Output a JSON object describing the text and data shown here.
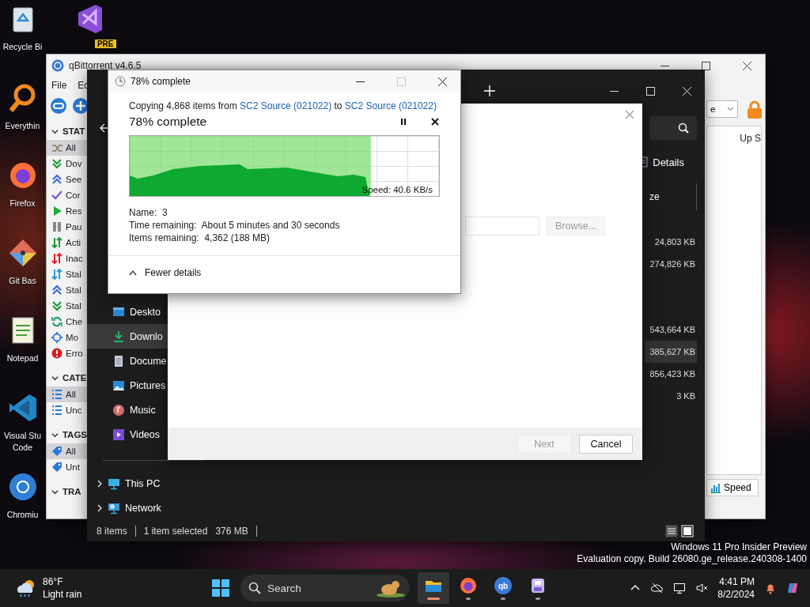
{
  "desktop_icons": [
    {
      "kind": "recycle-bin",
      "label": "Recycle Bi"
    },
    {
      "kind": "visual-studio",
      "badge": "PRE"
    },
    {
      "kind": "everything",
      "label": "Everythin"
    },
    {
      "kind": "firefox",
      "label": "Firefox"
    },
    {
      "kind": "git",
      "label": "Git Bas"
    },
    {
      "kind": "notepad",
      "label": "Notepad"
    },
    {
      "kind": "vscode",
      "label": "Visual Stu\nCode"
    },
    {
      "kind": "chromium",
      "label": "Chromiu"
    }
  ],
  "qbittorrent": {
    "title": "qBittorrent v4.6.5",
    "menu": [
      "File",
      "Ec"
    ],
    "sections": [
      {
        "header": "STAT",
        "expanded": true,
        "items": [
          {
            "kind": "all",
            "label": "All",
            "selected": true
          },
          {
            "kind": "downloading",
            "label": "Dov",
            "selected": false
          },
          {
            "kind": "seeding",
            "label": "See",
            "selected": false
          },
          {
            "kind": "completed",
            "label": "Cor",
            "selected": false
          },
          {
            "kind": "resumed",
            "label": "Res",
            "selected": false
          },
          {
            "kind": "paused",
            "label": "Pau",
            "selected": false
          },
          {
            "kind": "active",
            "label": "Acti",
            "selected": false
          },
          {
            "kind": "inactive",
            "label": "Inac",
            "selected": false
          },
          {
            "kind": "stalled",
            "label": "Stal",
            "selected": false
          },
          {
            "kind": "stalled-up",
            "label": "Stal",
            "selected": false
          },
          {
            "kind": "stalled-down",
            "label": "Stal",
            "selected": false
          },
          {
            "kind": "checking",
            "label": "Che",
            "selected": false
          },
          {
            "kind": "moving",
            "label": "Mo",
            "selected": false
          },
          {
            "kind": "errored",
            "label": "Erro",
            "selected": false
          }
        ]
      },
      {
        "header": "CATE",
        "expanded": true,
        "items": [
          {
            "kind": "category",
            "label": "All",
            "selected": true
          },
          {
            "kind": "category",
            "label": "Unc",
            "selected": false
          }
        ]
      },
      {
        "header": "TAGS",
        "expanded": true,
        "items": [
          {
            "kind": "tag",
            "label": "All",
            "selected": true
          },
          {
            "kind": "tag",
            "label": "Unt",
            "selected": false
          }
        ]
      },
      {
        "header": "TRA",
        "expanded": true
      }
    ],
    "filter_text": "e",
    "column_header": "Up S",
    "speed_button": "Speed"
  },
  "explorer": {
    "details_button": "Details",
    "size_header": "ze",
    "sizes": [
      {
        "value": "24,803 KB",
        "selected": false
      },
      {
        "value": "274,826 KB",
        "selected": false
      },
      {
        "value": "543,664 KB",
        "selected": false
      },
      {
        "value": "385,627 KB",
        "selected": true
      },
      {
        "value": "856,423 KB",
        "selected": false
      },
      {
        "value": "3 KB",
        "selected": false
      }
    ],
    "nav_items": [
      {
        "kind": "desktop",
        "label": "Deskto",
        "selected": false
      },
      {
        "kind": "downloads",
        "label": "Downlo",
        "selected": true
      },
      {
        "kind": "documents",
        "label": "Docume",
        "selected": false
      },
      {
        "kind": "pictures",
        "label": "Pictures",
        "selected": false
      },
      {
        "kind": "music",
        "label": "Music",
        "selected": false
      },
      {
        "kind": "videos",
        "label": "Videos",
        "selected": false
      }
    ],
    "tree_items": [
      {
        "kind": "this-pc",
        "label": "This PC",
        "expanded": false
      },
      {
        "kind": "network",
        "label": "Network",
        "expanded": false
      }
    ],
    "status": {
      "count": "8 items",
      "selection": "1 item selected",
      "size": "376 MB"
    }
  },
  "wizard": {
    "browse": {
      "label": "Browse...",
      "disabled": true
    },
    "buttons": [
      {
        "label": "Next",
        "disabled": true
      },
      {
        "label": "Cancel",
        "disabled": false
      }
    ]
  },
  "copy_dialog": {
    "title": "78% complete",
    "summary": {
      "prefix": "Copying 4,868 items from",
      "source": "SC2 Source (021022)",
      "middle": "to",
      "destination": "SC2 Source (021022)"
    },
    "heading": "78% complete",
    "progress": {
      "level": 0.78,
      "speed": "Speed: 40.6 KB/s"
    },
    "details": [
      {
        "label": "Name:",
        "value": "3"
      },
      {
        "label": "Time remaining:",
        "value": "About 5 minutes and 30 seconds"
      },
      {
        "label": "Items remaining:",
        "value": "4,362 (188 MB)"
      }
    ],
    "toggle": "Fewer details"
  },
  "watermark": [
    "Windows 11 Pro Insider Preview",
    "Evaluation copy. Build 26080.ge_release.240308-1400"
  ],
  "taskbar": {
    "weather": {
      "temp": "86°F",
      "condition": "Light rain"
    },
    "search": {
      "placeholder": "Search"
    },
    "apps": [
      {
        "kind": "file-explorer",
        "active": true
      },
      {
        "kind": "firefox",
        "active": false
      },
      {
        "kind": "qbittorrent",
        "label": "qb",
        "active": false
      },
      {
        "kind": "storage-app",
        "active": false
      }
    ],
    "clock": {
      "time": "4:41 PM",
      "date": "8/2/2024"
    }
  }
}
